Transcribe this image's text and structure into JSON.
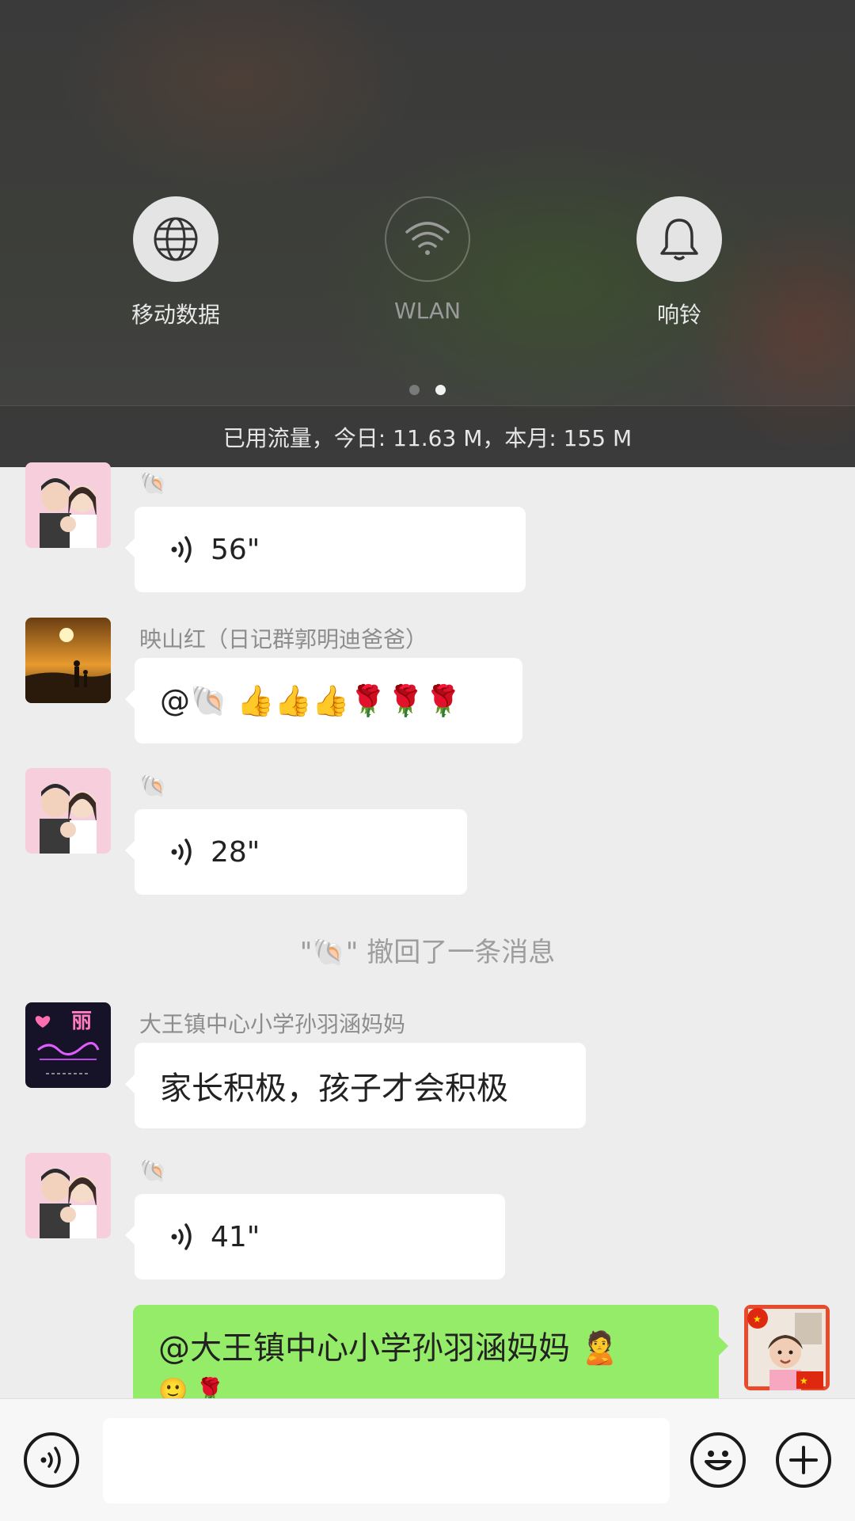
{
  "quick_settings": {
    "tiles": [
      {
        "label": "移动数据",
        "icon": "globe-icon",
        "state": "on"
      },
      {
        "label": "WLAN",
        "icon": "wifi-icon",
        "state": "off"
      },
      {
        "label": "响铃",
        "icon": "bell-icon",
        "state": "on"
      }
    ],
    "page_indicator": {
      "pages": 2,
      "active": 2
    },
    "data_usage": "已用流量，今日: 11.63 M，本月: 155 M"
  },
  "chat": {
    "messages": [
      {
        "type": "voice",
        "sender": "🐚",
        "duration": "56\""
      },
      {
        "type": "text",
        "sender": "映山红（日记群郭明迪爸爸）",
        "text": "@🐚 👍👍👍🌹🌹🌹"
      },
      {
        "type": "voice",
        "sender": "🐚",
        "duration": "28\""
      },
      {
        "type": "system",
        "text": "\"🐚\" 撤回了一条消息"
      },
      {
        "type": "text",
        "sender": "大王镇中心小学孙羽涵妈妈",
        "text": "家长积极，孩子才会积极"
      },
      {
        "type": "voice",
        "sender": "🐚",
        "duration": "41\""
      },
      {
        "type": "self_text",
        "text": "@大王镇中心小学孙羽涵妈妈 🙎",
        "text_line2": "🙂 🌹"
      }
    ]
  },
  "colors": {
    "self_bubble": "#95ec69",
    "chat_bg": "#ededed"
  },
  "input_bar": {
    "icons": [
      "voice-icon",
      "emoji-icon",
      "plus-icon"
    ],
    "placeholder": ""
  }
}
